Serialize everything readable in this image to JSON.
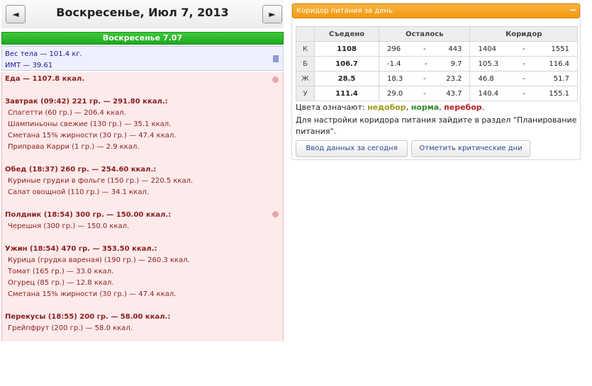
{
  "header": {
    "prev_label": "◄",
    "next_label": "►",
    "date_title": "Воскресенье, Июл 7, 2013"
  },
  "day_bar": "Воскресенье 7.07",
  "body_stats": {
    "weight": "Вес тела — 101.4 кг.",
    "bmi": "ИМТ — 39.61"
  },
  "food": {
    "total": "Еда — 1107.8 ккал.",
    "breakfast": {
      "title": "Завтрак (09:42) 221 гр. — 291.80 ккал.:",
      "items": [
        "Спагетти (60 гр.) — 206.4 ккал.",
        "Шампиньоны свежие (130 гр.) — 35.1 ккал.",
        "Сметана 15% жирности (30 гр.) — 47.4 ккал.",
        "Приправа Карри (1 гр.) — 2.9 ккал."
      ]
    },
    "lunch": {
      "title": "Обед (18:37) 260 гр. — 254.60 ккал.:",
      "items": [
        "Куриные грудки в фольге (150 гр.) — 220.5 ккал.",
        "Салат овощной (110 гр.) — 34.1 ккал."
      ]
    },
    "snack": {
      "title": "Полдник (18:54) 300 гр. — 150.00 ккал.:",
      "items": [
        "Черешня (300 гр.) — 150.0 ккал."
      ]
    },
    "dinner": {
      "title": "Ужин (18:54) 470 гр. — 353.50 ккал.:",
      "items": [
        "Курица (грудка вареная) (190 гр.) — 260.3 ккал.",
        "Томат (165 гр.) — 33.0 ккал.",
        "Огурец (85 гр.) — 12.8 ккал.",
        "Сметана 15% жирности (30 гр.) — 47.4 ккал."
      ]
    },
    "bites": {
      "title": "Перекусы (18:55) 200 гр. — 58.00 ккал.:",
      "items": [
        "Грейпфрут (200 гр.) — 58.0 ккал."
      ]
    }
  },
  "corridor": {
    "title": "Коридор питания за день",
    "collapse_label": "−",
    "columns": [
      "Съедено",
      "Осталось",
      "Коридор"
    ],
    "dash": "-",
    "rows": [
      {
        "label": "К",
        "eaten": "1108",
        "eaten_status": "low",
        "rem_min": "296",
        "rem_max": "443",
        "cor_min": "1404",
        "cor_max": "1551"
      },
      {
        "label": "Б",
        "eaten": "106.7",
        "eaten_status": "norm",
        "rem_min": "-1.4",
        "rem_max": "9.7",
        "cor_min": "105.3",
        "cor_max": "116.4"
      },
      {
        "label": "Ж",
        "eaten": "28.5",
        "eaten_status": "low",
        "rem_min": "18.3",
        "rem_max": "23.2",
        "cor_min": "46.8",
        "cor_max": "51.7"
      },
      {
        "label": "У",
        "eaten": "111.4",
        "eaten_status": "low",
        "rem_min": "29.0",
        "rem_max": "43.7",
        "cor_min": "140.4",
        "cor_max": "155.1"
      }
    ],
    "legend": {
      "prefix": "Цвета означают:",
      "low": "недобор",
      "sep1": ",",
      "norm": "норма",
      "sep2": ",",
      "over": "перебор",
      "end": "."
    },
    "hint": "Для настройки коридора питания зайдите в раздел \"Планирование питания\".",
    "btn_today": "Ввод данных за сегодня",
    "btn_critical": "Отметить критические дни"
  },
  "colors": {
    "low": "#9a9a1a",
    "norm": "#2e8b2e",
    "over": "#b82020",
    "header_orange": "#f5a623",
    "day_green": "#22aa22"
  }
}
